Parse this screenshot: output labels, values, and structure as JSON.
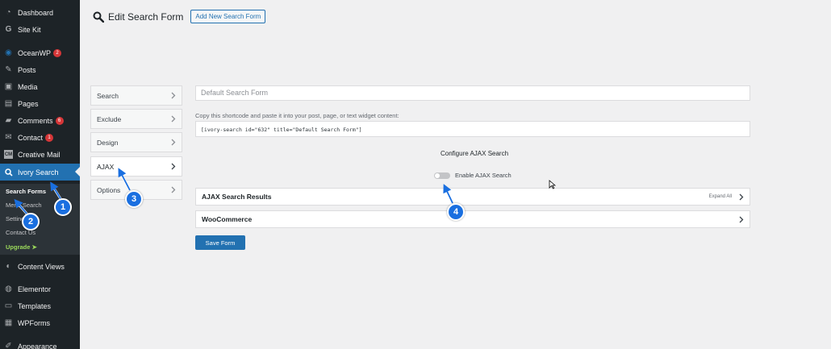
{
  "sidebar": {
    "items": [
      {
        "label": "Dashboard",
        "icon": "dashboard-icon",
        "glyph": "◔"
      },
      {
        "label": "Site Kit",
        "icon": "google-g-icon",
        "glyph": "G"
      },
      {
        "label": "OceanWP",
        "icon": "oceanwp-icon",
        "glyph": "◉",
        "badge": "2"
      },
      {
        "label": "Posts",
        "icon": "pushpin-icon",
        "glyph": "✎"
      },
      {
        "label": "Media",
        "icon": "media-icon",
        "glyph": "▣"
      },
      {
        "label": "Pages",
        "icon": "pages-icon",
        "glyph": "▤"
      },
      {
        "label": "Comments",
        "icon": "comments-icon",
        "glyph": "▰",
        "badge": "6"
      },
      {
        "label": "Contact",
        "icon": "mail-icon",
        "glyph": "✉",
        "badge": "1"
      },
      {
        "label": "Creative Mail",
        "icon": "creative-mail-icon",
        "glyph": "CM"
      },
      {
        "label": "Ivory Search",
        "icon": "search-icon",
        "glyph": "⚲"
      },
      {
        "label": "Content Views",
        "icon": "content-views-icon",
        "glyph": "◐"
      },
      {
        "label": "Elementor",
        "icon": "elementor-icon",
        "glyph": "◍"
      },
      {
        "label": "Templates",
        "icon": "folder-icon",
        "glyph": "▭"
      },
      {
        "label": "WPForms",
        "icon": "wpforms-icon",
        "glyph": "▦"
      },
      {
        "label": "Appearance",
        "icon": "brush-icon",
        "glyph": "✐"
      }
    ],
    "submenu": [
      "Search Forms",
      "Menu Search",
      "Settings",
      "Contact Us",
      "Upgrade ➤"
    ]
  },
  "header": {
    "title": "Edit Search Form",
    "add_new_label": "Add New Search Form"
  },
  "tabs": [
    "Search",
    "Exclude",
    "Design",
    "AJAX",
    "Options"
  ],
  "main": {
    "form_name_placeholder": "Default Search Form",
    "copy_hint": "Copy this shortcode and paste it into your post, page, or text widget content:",
    "shortcode": "[ivory-search id=\"632\" title=\"Default Search Form\"]",
    "configure_title": "Configure AJAX Search",
    "toggle_label": "Enable AJAX Search",
    "sections": [
      {
        "label": "AJAX Search Results",
        "aside": "Expand All"
      },
      {
        "label": "WooCommerce",
        "aside": ""
      }
    ],
    "save_label": "Save Form"
  },
  "annotations": [
    "1",
    "2",
    "3",
    "4"
  ],
  "colors": {
    "sidebar_bg": "#1d2327",
    "accent": "#2271b1",
    "badge": "#d63638",
    "callout": "#1a6fe0",
    "upgrade": "#9bd95b"
  }
}
